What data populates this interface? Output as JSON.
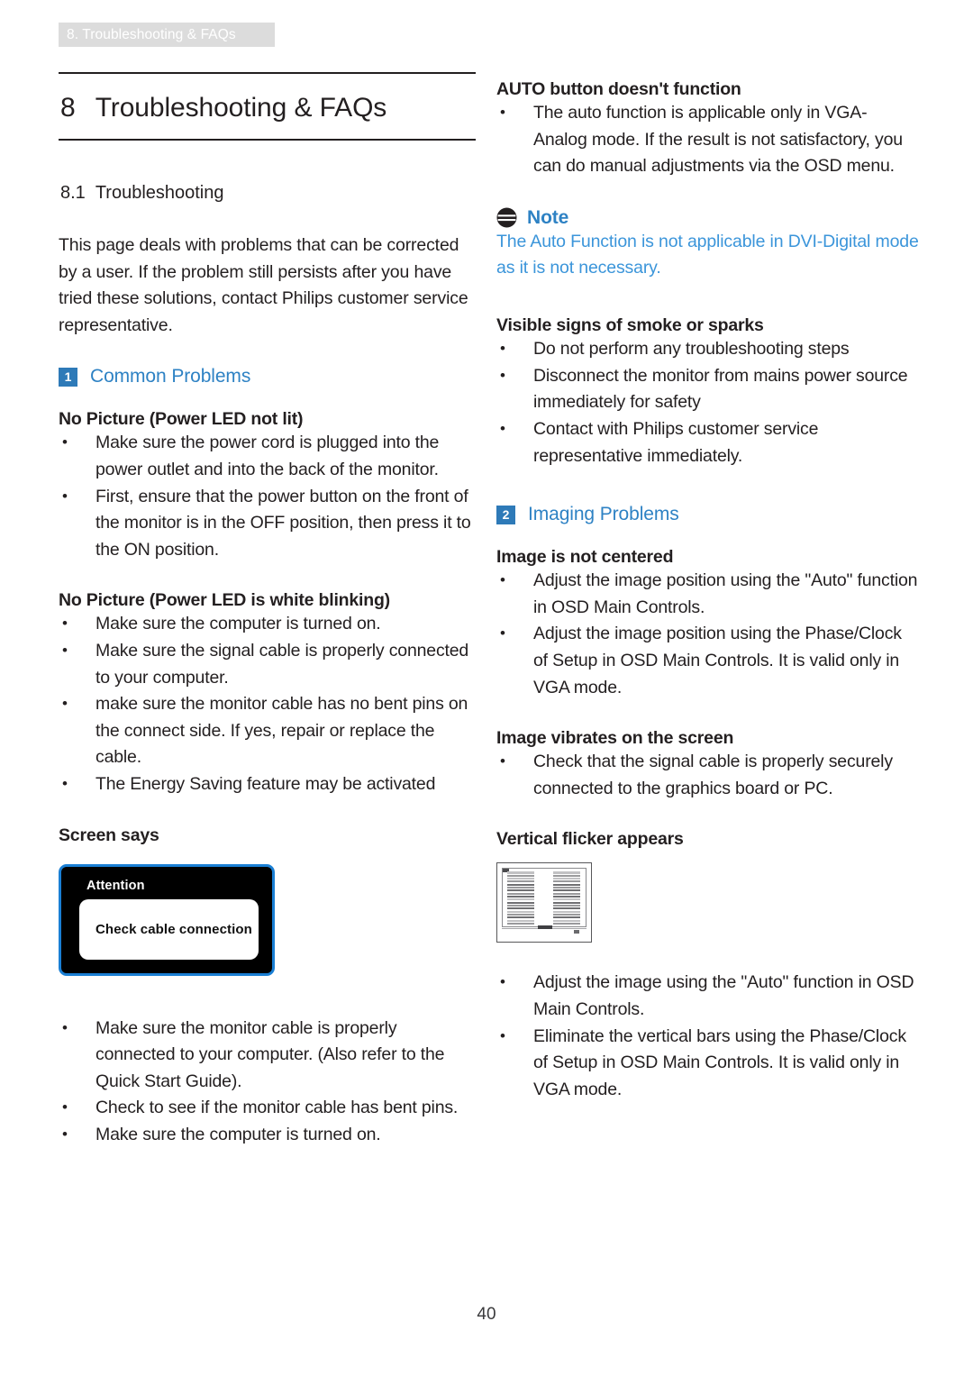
{
  "header": {
    "running_tab": "8. Troubleshooting & FAQs"
  },
  "title": {
    "number": "8",
    "name": "Troubleshooting & FAQs"
  },
  "section": {
    "number": "8.1",
    "name": "Troubleshooting"
  },
  "intro_paragraph": "This page deals with problems that can be corrected by a user. If the problem still persists after you have tried these solutions, contact Philips customer service representative.",
  "left_column": {
    "common_problems": {
      "badge": "1",
      "label": "Common Problems"
    },
    "no_picture_not_lit": {
      "heading": "No Picture (Power LED not lit)",
      "bullets": [
        "Make sure the power cord is plugged into the power outlet and into the back of the monitor.",
        "First, ensure that the power button on the front of the monitor is in the OFF position, then press it to the ON position."
      ]
    },
    "no_picture_blinking": {
      "heading": "No Picture (Power LED is white blinking)",
      "bullets": [
        "Make sure the computer is turned on.",
        "Make sure the signal cable is properly connected to your computer.",
        "make sure the monitor cable has no bent pins on the connect side. If yes, repair or replace the cable.",
        "The Energy Saving feature may be activated"
      ]
    },
    "screen_says": {
      "heading": "Screen says",
      "osd": {
        "title": "Attention",
        "message": "Check cable connection",
        "border_color": "#1a7fd4",
        "background_color": "#000000"
      },
      "bullets": [
        "Make sure the monitor cable is properly connected to your computer. (Also refer to the Quick Start Guide).",
        "Check to see if the monitor cable has bent pins.",
        "Make sure the computer is turned on."
      ]
    }
  },
  "right_column": {
    "auto_button": {
      "heading": "AUTO button doesn't function",
      "bullets": [
        "The auto function is applicable only in VGA-Analog mode.  If the result is not satisfactory, you can do manual adjustments via the OSD menu."
      ]
    },
    "note": {
      "icon": "note-icon",
      "label": "Note",
      "body": "The Auto Function is not applicable in DVI-Digital mode as it is not necessary.",
      "color": "#3b95da"
    },
    "smoke_sparks": {
      "heading": "Visible signs of smoke or sparks",
      "bullets": [
        "Do not perform any troubleshooting steps",
        "Disconnect the monitor from mains power source immediately for safety",
        "Contact with Philips customer service representative immediately."
      ]
    },
    "imaging_problems": {
      "badge": "2",
      "label": "Imaging Problems"
    },
    "not_centered": {
      "heading": "Image is not centered",
      "bullets": [
        "Adjust the image position using the \"Auto\" function in OSD Main Controls.",
        "Adjust the image position using the Phase/Clock of Setup in OSD Main Controls.  It is valid only in VGA mode."
      ]
    },
    "vibrates": {
      "heading": "Image vibrates on the screen",
      "bullets": [
        "Check that the signal cable is properly securely connected to the graphics board or PC."
      ]
    },
    "vertical_flicker": {
      "heading": "Vertical flicker appears",
      "figure_name": "vertical-flicker-illustration",
      "bullets": [
        "Adjust the image using the \"Auto\" function in OSD Main Controls.",
        "Eliminate the vertical bars using the Phase/Clock of Setup in OSD Main Controls. It is valid only in VGA mode."
      ]
    }
  },
  "footer": {
    "page_number": "40"
  },
  "colors": {
    "accent_blue": "#2e82c4",
    "badge_blue": "#2e7ab8",
    "note_blue": "#3b95da",
    "header_tab_gray": "#dcdcdc",
    "text": "#231f20"
  }
}
